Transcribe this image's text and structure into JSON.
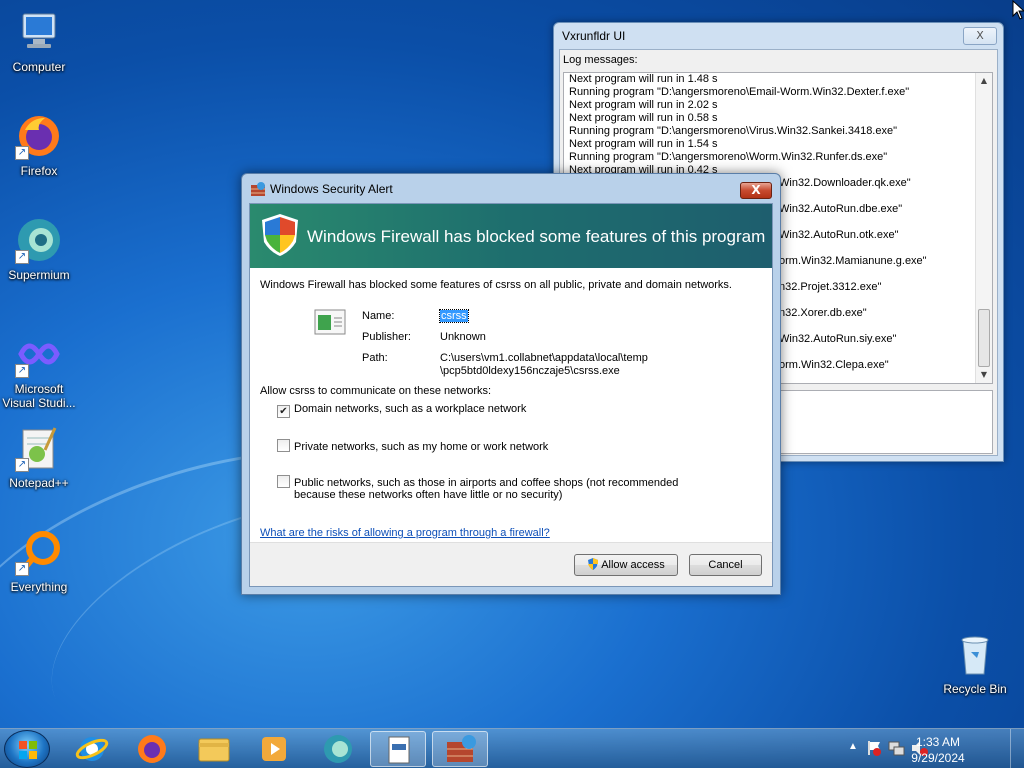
{
  "desktop": {
    "icons": [
      {
        "label": "Computer"
      },
      {
        "label": "Firefox"
      },
      {
        "label": "Supermium"
      },
      {
        "label_line1": "Microsoft",
        "label_line2": "Visual Studi..."
      },
      {
        "label": "Notepad++"
      },
      {
        "label": "Everything"
      },
      {
        "label": "Recycle Bin"
      }
    ]
  },
  "log_window": {
    "title": "Vxrunfldr UI",
    "close_label": "X",
    "log_label": "Log messages:",
    "lines": [
      "Next program will run in 1.48 s",
      "Running program \"D:\\angersmoreno\\Email-Worm.Win32.Dexter.f.exe\"",
      "Next program will run in 2.02 s",
      "Next program will run in 0.58 s",
      "Running program \"D:\\angersmoreno\\Virus.Win32.Sankei.3418.exe\"",
      "Next program will run in 1.54 s",
      "Running program \"D:\\angersmoreno\\Worm.Win32.Runfer.ds.exe\"",
      "Next program will run in 0.42 s"
    ],
    "visible_fragments": [
      "Win32.Downloader.qk.exe\"",
      "Win32.AutoRun.dbe.exe\"",
      "Win32.AutoRun.otk.exe\"",
      "orm.Win32.Mamianune.g.exe\"",
      "n32.Projet.3312.exe\"",
      "n32.Xorer.db.exe\"",
      "Win32.AutoRun.siy.exe\"",
      "orm.Win32.Clepa.exe\""
    ]
  },
  "alert": {
    "title": "Windows Security Alert",
    "close_label": "X",
    "banner": "Windows Firewall has blocked some features of this program",
    "description": "Windows Firewall has blocked some features of csrss on all public, private and domain networks.",
    "name_label": "Name:",
    "name_value": "csrss",
    "publisher_label": "Publisher:",
    "publisher_value": "Unknown",
    "path_label": "Path:",
    "path_line1": "C:\\users\\vm1.collabnet\\appdata\\local\\temp",
    "path_line2": "\\pcp5btd0ldexy156nczaje5\\csrss.exe",
    "allow_prompt": "Allow csrss to communicate on these networks:",
    "networks": [
      {
        "label": "Domain networks, such as a workplace network",
        "checked": true
      },
      {
        "label": "Private networks, such as my home or work network",
        "checked": false
      },
      {
        "label_line1": "Public networks, such as those in airports and coffee shops (not recommended",
        "label_line2": "because these networks often have little or no security)",
        "checked": false
      }
    ],
    "risk_link": "What are the risks of allowing a program through a firewall?",
    "allow_button": "Allow access",
    "cancel_button": "Cancel"
  },
  "taskbar": {
    "clock_time": "1:33 AM",
    "clock_date": "9/29/2024"
  }
}
